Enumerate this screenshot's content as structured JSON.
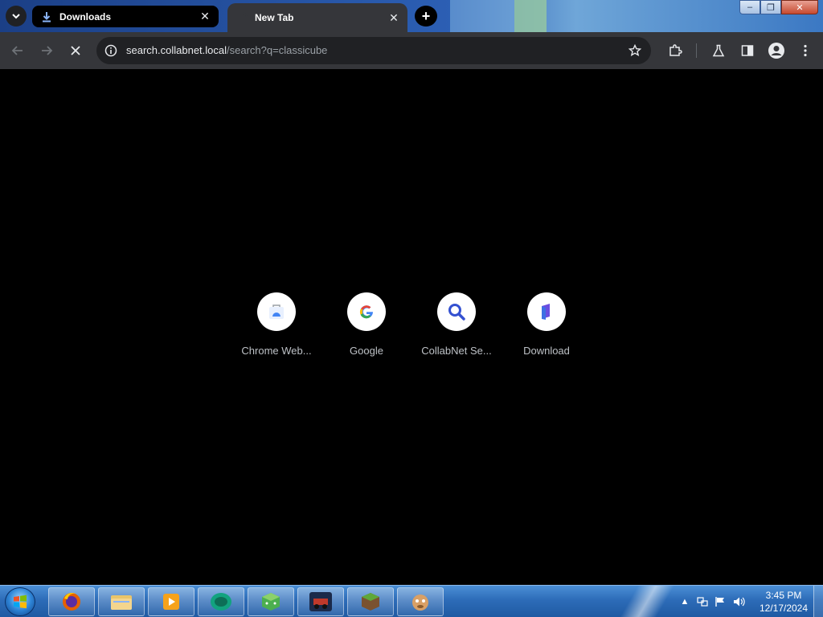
{
  "browser": {
    "tabs": [
      {
        "title": "Downloads",
        "icon": "download-icon",
        "active": false
      },
      {
        "title": "New Tab",
        "icon": "loading-icon",
        "active": true
      }
    ],
    "window_controls": {
      "minimize": "–",
      "restore": "❐",
      "close": "✕"
    },
    "omnibox": {
      "host": "search.collabnet.local",
      "path": "/search?q=classicube"
    },
    "colors": {
      "tab_active": "#35363a",
      "toolbar": "#35363a",
      "omnibox": "#202124",
      "page_bg": "#000000"
    }
  },
  "shortcuts": [
    {
      "label": "Chrome Web...",
      "icon": "chrome-web-store-icon"
    },
    {
      "label": "Google",
      "icon": "google-icon"
    },
    {
      "label": "CollabNet Se...",
      "icon": "search-icon"
    },
    {
      "label": "Download",
      "icon": "download-app-icon"
    }
  ],
  "taskbar": {
    "apps": [
      {
        "name": "firefox",
        "icon": "firefox-icon"
      },
      {
        "name": "file-explorer",
        "icon": "folder-icon"
      },
      {
        "name": "media-player",
        "icon": "media-player-icon"
      },
      {
        "name": "app-4",
        "icon": "green-circle-icon"
      },
      {
        "name": "app-5",
        "icon": "green-dice-icon"
      },
      {
        "name": "app-6",
        "icon": "game-truck-icon"
      },
      {
        "name": "minecraft",
        "icon": "grass-block-icon"
      },
      {
        "name": "app-8",
        "icon": "cartoon-icon"
      }
    ],
    "clock": {
      "time": "3:45 PM",
      "date": "12/17/2024"
    }
  }
}
